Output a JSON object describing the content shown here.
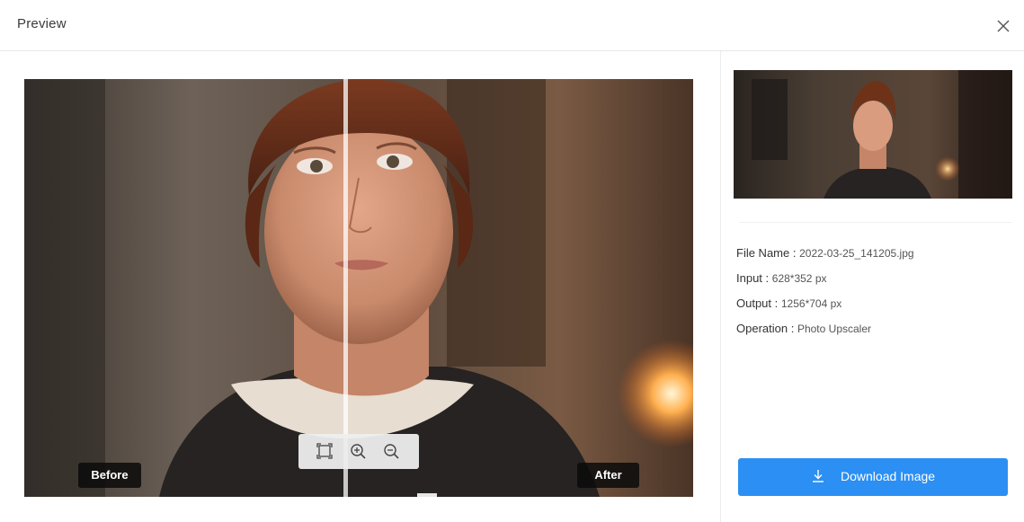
{
  "dialog": {
    "title": "Preview",
    "close_icon": "close-icon"
  },
  "viewer": {
    "before_label": "Before",
    "after_label": "After",
    "split_position": 0.48,
    "toolbar": {
      "tools": [
        "fit-screen-icon",
        "zoom-in-icon",
        "zoom-out-icon"
      ]
    }
  },
  "details": {
    "file_name_label": "File Name :",
    "file_name_value": "2022-03-25_141205.jpg",
    "input_label": "Input :",
    "input_value": "628*352 px",
    "output_label": "Output :",
    "output_value": "1256*704 px",
    "operation_label": "Operation :",
    "operation_value": "Photo Upscaler"
  },
  "actions": {
    "download_label": "Download Image",
    "download_icon": "download-icon"
  },
  "colors": {
    "accent": "#2b8ff3",
    "tag_bg": "#0a0a0a"
  }
}
